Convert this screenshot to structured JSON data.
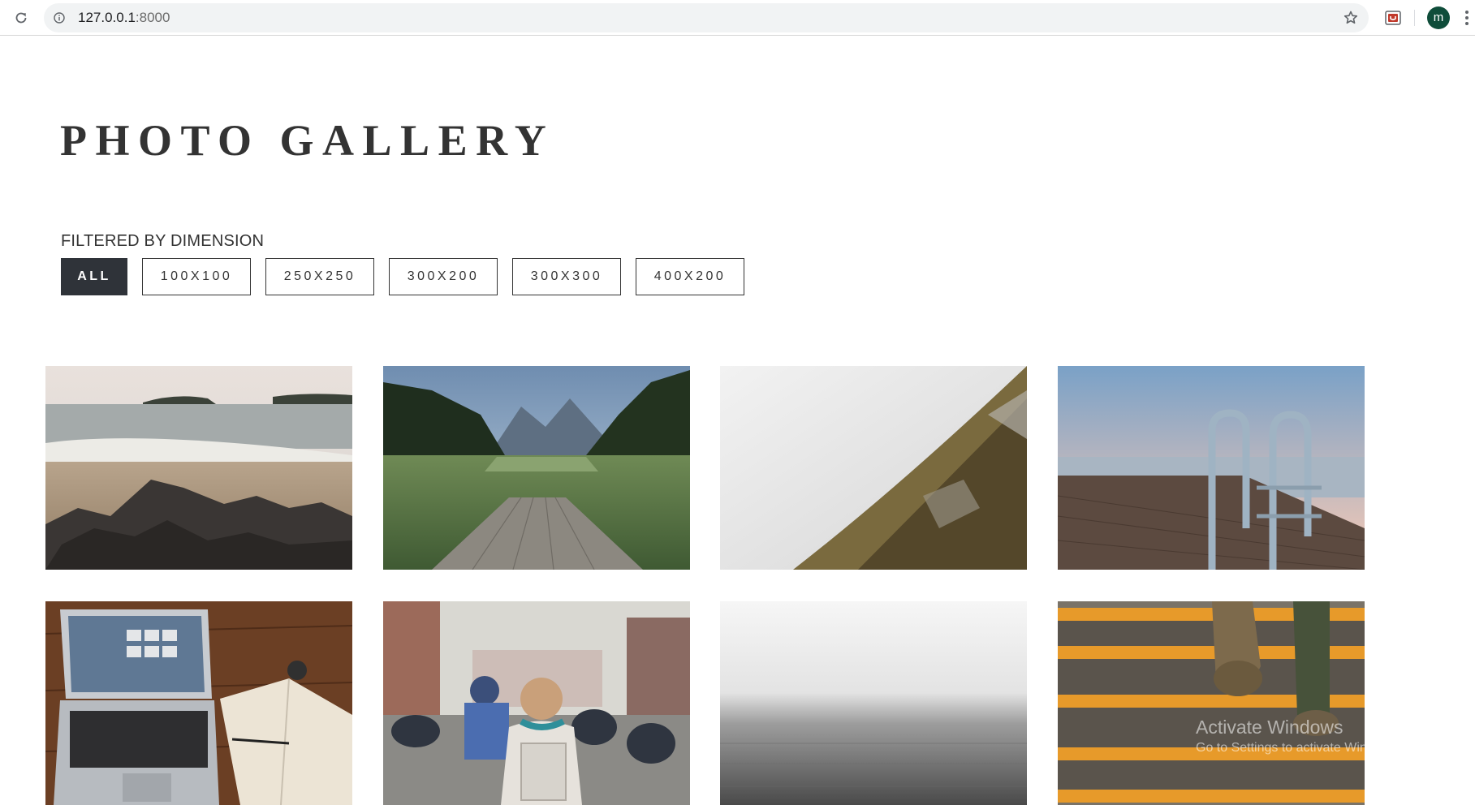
{
  "browser": {
    "url_host": "127.0.0.1",
    "url_port": ":8000",
    "avatar_letter": "m"
  },
  "page": {
    "title": "PHOTO GALLERY",
    "filter_label": "FILTERED BY DIMENSION",
    "filters": [
      {
        "label": "ALL",
        "active": true
      },
      {
        "label": "100X100",
        "active": false
      },
      {
        "label": "250X250",
        "active": false
      },
      {
        "label": "300X200",
        "active": false
      },
      {
        "label": "300X300",
        "active": false
      },
      {
        "label": "400X200",
        "active": false
      }
    ]
  },
  "gallery": {
    "photos": [
      {
        "subject": "beach-rocks"
      },
      {
        "subject": "lake-dock-forest"
      },
      {
        "subject": "foggy-mountain-slope"
      },
      {
        "subject": "pier-ladder-sunset"
      },
      {
        "subject": "laptop-desk"
      },
      {
        "subject": "street-scooters"
      },
      {
        "subject": "foggy-sea"
      },
      {
        "subject": "stairs-feet"
      }
    ]
  },
  "watermark": {
    "title": "Activate Windows",
    "subtitle": "Go to Settings to activate Windows."
  }
}
